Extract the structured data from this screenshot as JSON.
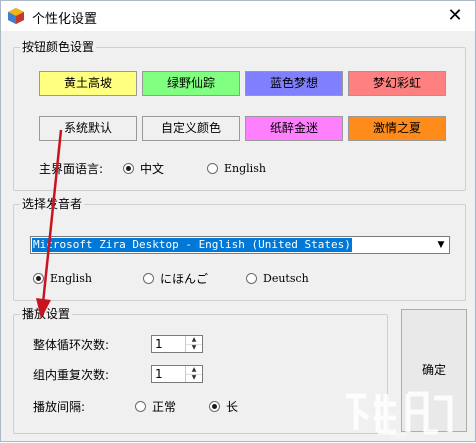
{
  "window": {
    "title": "个性化设置",
    "close_glyph": "✕"
  },
  "button_colors": {
    "title": "按钮颜色设置",
    "buttons": [
      {
        "label": "黄土高坡",
        "color": "#ffff80"
      },
      {
        "label": "绿野仙踪",
        "color": "#80ff80"
      },
      {
        "label": "蓝色梦想",
        "color": "#8080ff"
      },
      {
        "label": "梦幻彩虹",
        "color": "#ff8080"
      },
      {
        "label": "系统默认",
        "color": "#f0f0f0"
      },
      {
        "label": "自定义颜色",
        "color": "#f0f0f0"
      },
      {
        "label": "纸醉金迷",
        "color": "#ff80ff"
      },
      {
        "label": "激情之夏",
        "color": "#ff8c1a"
      }
    ],
    "language_label": "主界面语言:",
    "language_options": [
      "中文",
      "English"
    ],
    "language_selected": "中文"
  },
  "voice": {
    "title": "选择发音者",
    "selected_voice": "Microsoft Zira Desktop - English (United States)",
    "language_options": [
      "English",
      "にほんご",
      "Deutsch"
    ],
    "language_selected": "English"
  },
  "playback": {
    "title": "播放设置",
    "loop_label": "整体循环次数:",
    "loop_value": "1",
    "repeat_label": "组内重复次数:",
    "repeat_value": "1",
    "interval_label": "播放间隔:",
    "interval_options": [
      "正常",
      "长"
    ],
    "interval_selected": "长"
  },
  "ok_label": "确定",
  "watermark_text": "下载吧",
  "colors": {
    "annotation_arrow": "#c8141e",
    "selection": "#0078d7"
  }
}
